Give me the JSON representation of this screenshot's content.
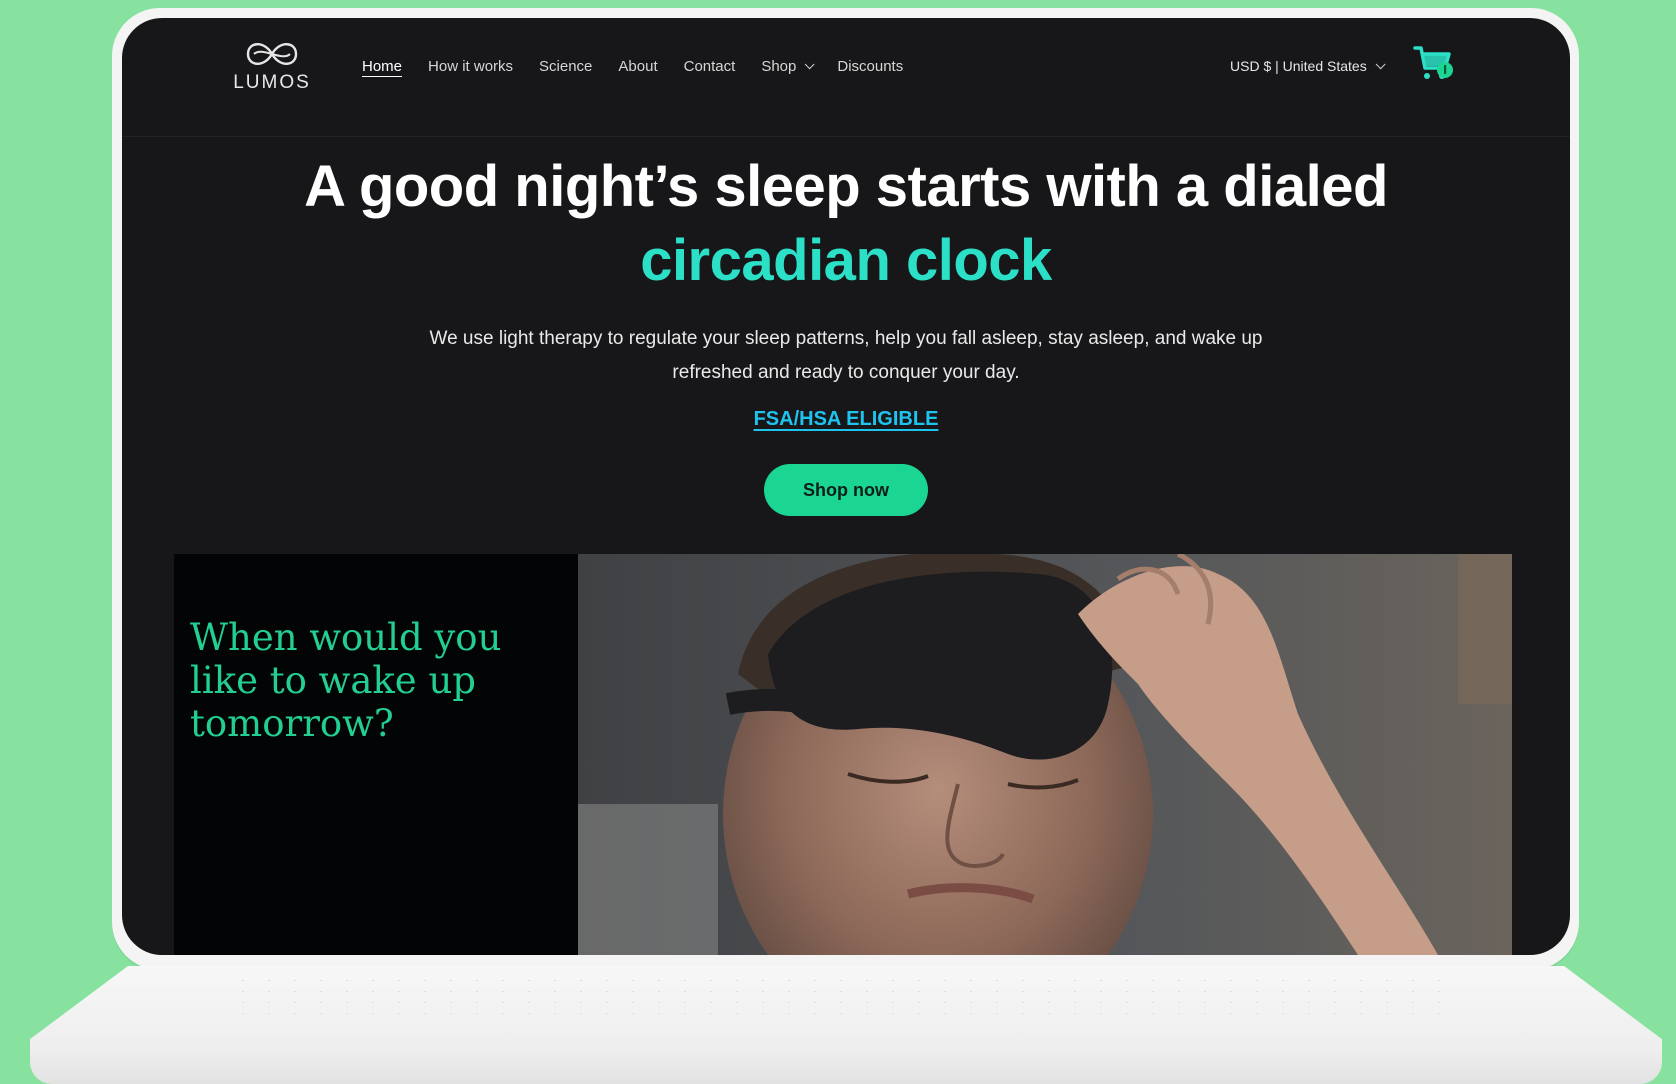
{
  "brand": {
    "logo_text": "LUMOS",
    "accent_color": "#2ce0c8",
    "cta_color": "#1bd592",
    "link_color": "#1ec3ee",
    "background_color": "#86e29e"
  },
  "nav": {
    "items": [
      {
        "label": "Home",
        "active": true
      },
      {
        "label": "How it works"
      },
      {
        "label": "Science"
      },
      {
        "label": "About"
      },
      {
        "label": "Contact"
      },
      {
        "label": "Shop",
        "has_dropdown": true
      },
      {
        "label": "Discounts"
      }
    ]
  },
  "locale": {
    "label": "USD $ | United States"
  },
  "cart": {
    "icon": "cart-icon"
  },
  "hero": {
    "title_line1": "A good night’s sleep starts with a dialed",
    "title_line2": "circadian clock",
    "subtitle": "We use light therapy to regulate your sleep patterns, help you fall asleep, stay asleep, and wake up refreshed and ready to conquer your day.",
    "fsa_link": "FSA/HSA ELIGIBLE",
    "cta_label": "Shop now"
  },
  "video": {
    "question": "When would you like to wake up tomorrow?"
  }
}
